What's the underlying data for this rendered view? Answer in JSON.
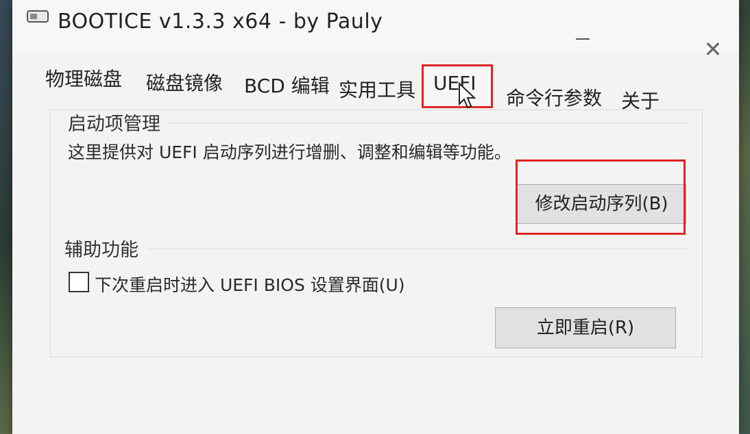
{
  "window": {
    "title": "BOOTICE v1.3.3 x64 - by Pauly",
    "close_glyph": "✕"
  },
  "tabs": [
    {
      "label": "物理磁盘",
      "active": false
    },
    {
      "label": "磁盘镜像",
      "active": false
    },
    {
      "label": "BCD 编辑",
      "active": false
    },
    {
      "label": "实用工具",
      "active": false
    },
    {
      "label": "UEFI",
      "active": true
    },
    {
      "label": "命令行参数",
      "active": false
    },
    {
      "label": "关于",
      "active": false
    }
  ],
  "boot_manager": {
    "title": "启动项管理",
    "description": "这里提供对 UEFI 启动序列进行增删、调整和编辑等功能。",
    "edit_button": "修改启动序列(B)"
  },
  "aux": {
    "title": "辅助功能",
    "checkbox_label": "下次重启时进入 UEFI BIOS 设置界面(U)",
    "checkbox_checked": false,
    "reboot_button": "立即重启(R)"
  },
  "colors": {
    "highlight": "#e02424",
    "window_bg": "#f3f3f3"
  },
  "icons": {
    "app": "bootice-drive-icon",
    "cursor": "mouse-pointer-icon",
    "close": "close-icon"
  }
}
